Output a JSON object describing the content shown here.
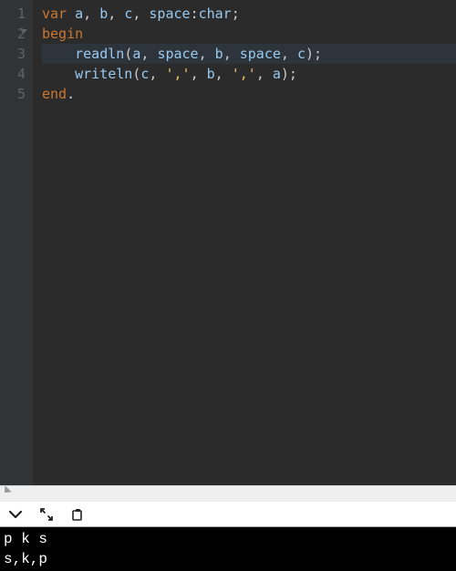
{
  "editor": {
    "highlighted_line_index": 2,
    "lines": [
      {
        "num": "1",
        "foldable": false,
        "tokens": [
          {
            "t": "var ",
            "c": "kw"
          },
          {
            "t": "a",
            "c": "id"
          },
          {
            "t": ", ",
            "c": "punc"
          },
          {
            "t": "b",
            "c": "id"
          },
          {
            "t": ", ",
            "c": "punc"
          },
          {
            "t": "c",
            "c": "id"
          },
          {
            "t": ", ",
            "c": "punc"
          },
          {
            "t": "space",
            "c": "id"
          },
          {
            "t": ":",
            "c": "punc"
          },
          {
            "t": "char",
            "c": "id"
          },
          {
            "t": ";",
            "c": "punc"
          }
        ]
      },
      {
        "num": "2",
        "foldable": true,
        "tokens": [
          {
            "t": "begin",
            "c": "kw"
          }
        ]
      },
      {
        "num": "3",
        "foldable": false,
        "tokens": [
          {
            "t": "    readln",
            "c": "id"
          },
          {
            "t": "(",
            "c": "punc"
          },
          {
            "t": "a",
            "c": "id"
          },
          {
            "t": ", ",
            "c": "punc"
          },
          {
            "t": "space",
            "c": "id"
          },
          {
            "t": ", ",
            "c": "punc"
          },
          {
            "t": "b",
            "c": "id"
          },
          {
            "t": ", ",
            "c": "punc"
          },
          {
            "t": "space",
            "c": "id"
          },
          {
            "t": ", ",
            "c": "punc"
          },
          {
            "t": "c",
            "c": "id"
          },
          {
            "t": ");",
            "c": "punc"
          }
        ]
      },
      {
        "num": "4",
        "foldable": false,
        "tokens": [
          {
            "t": "    writeln",
            "c": "id"
          },
          {
            "t": "(",
            "c": "punc"
          },
          {
            "t": "c",
            "c": "id"
          },
          {
            "t": ", ",
            "c": "punc"
          },
          {
            "t": "','",
            "c": "str"
          },
          {
            "t": ", ",
            "c": "punc"
          },
          {
            "t": "b",
            "c": "id"
          },
          {
            "t": ", ",
            "c": "punc"
          },
          {
            "t": "','",
            "c": "str"
          },
          {
            "t": ", ",
            "c": "punc"
          },
          {
            "t": "a",
            "c": "id"
          },
          {
            "t": ");",
            "c": "punc"
          }
        ]
      },
      {
        "num": "5",
        "foldable": false,
        "tokens": [
          {
            "t": "end",
            "c": "kw"
          },
          {
            "t": ".",
            "c": "punc"
          }
        ]
      }
    ]
  },
  "toolbar": {
    "icons": [
      "chevron-down-icon",
      "expand-icon",
      "copy-icon"
    ]
  },
  "console": {
    "lines": [
      "p k s",
      "s,k,p"
    ]
  }
}
